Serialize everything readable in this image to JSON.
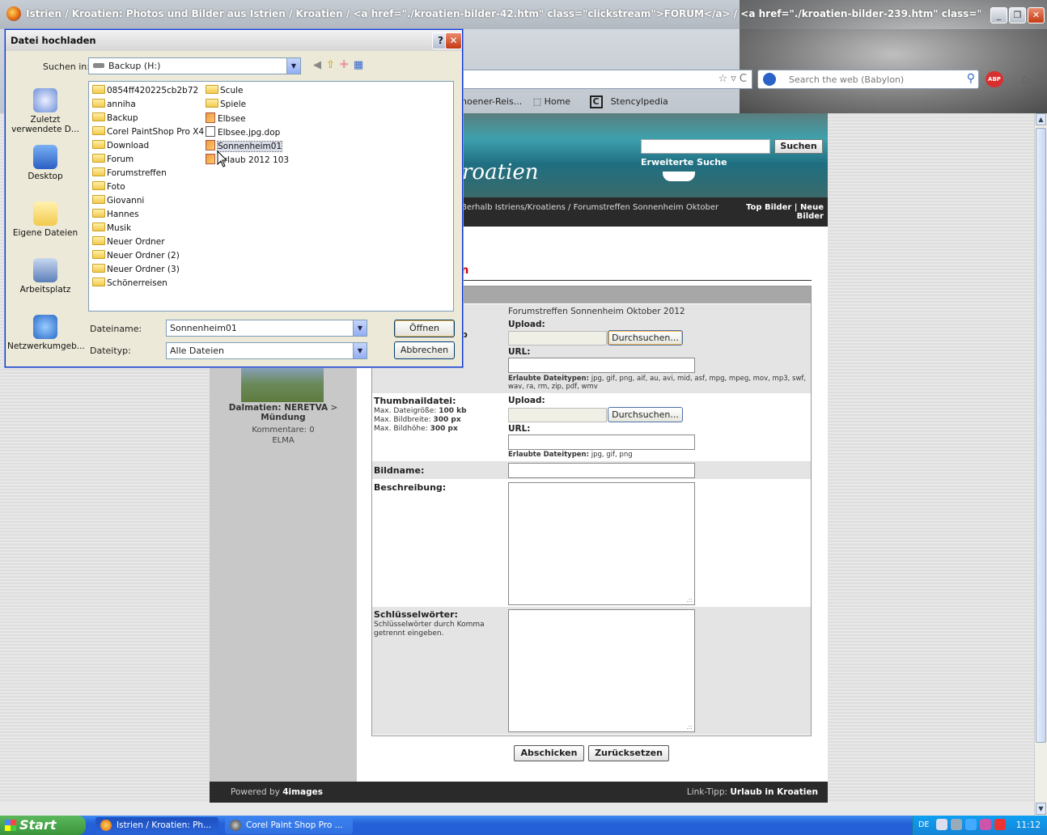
{
  "browser": {
    "window_title": "Istrien / Kroatien: Photos und Bilder aus Istrien / Kroatien / <a href=\"./kroatien-bilder-42.htm\" class=\"clickstream\">FORUM</a> / <a href=\"./kroatien-bilder-239.htm\" class=\"clickstream\"...",
    "search_placeholder": "Search the web (Babylon)",
    "bookmarks": [
      "hoener-Reis...",
      "Home",
      "Stencylpedia"
    ],
    "bookmark_c_icon": "C",
    "abp_label": "ABP"
  },
  "site": {
    "logo": "roatien",
    "search_button": "Suchen",
    "advanced_search": "Erweiterte Suche",
    "breadcrumb": "Berhalb Istriens/Kroatiens / Forumstreffen Sonnenheim Oktober",
    "top_bilder": "Top Bilder",
    "sep": "|",
    "neue_bilder": "Neue Bilder",
    "heading_fragment": "n",
    "thumb": {
      "title": "Dalmatien: NERETVA",
      "arrow": ">",
      "subtitle": "Mündung",
      "comments": "Kommentare: 0",
      "user": "ELMA"
    },
    "form": {
      "category_value": "Forumstreffen Sonnenheim Oktober 2012",
      "partial_label": "b",
      "upload_label": "Upload:",
      "browse_button": "Durchsuchen...",
      "url_label": "URL:",
      "allowed_label": "Erlaubte Dateitypen:",
      "allowed_main": "jpg, gif, png, aif, au, avi, mid, asf, mpg, mpeg, mov, mp3, swf, wav, ra, rm, zip, pdf, wmv",
      "thumb_label": "Thumbnaildatei:",
      "thumb_size_lbl": "Max. Dateigröße:",
      "thumb_size": "100 kb",
      "thumb_w_lbl": "Max. Bildbreite:",
      "thumb_w": "300 px",
      "thumb_h_lbl": "Max. Bildhöhe:",
      "thumb_h": "300 px",
      "allowed_thumb": "jpg, gif, png",
      "name_label": "Bildname:",
      "desc_label": "Beschreibung:",
      "keywords_label": "Schlüsselwörter:",
      "keywords_hint": "Schlüsselwörter durch Komma getrennt eingeben.",
      "submit": "Abschicken",
      "reset": "Zurücksetzen"
    },
    "footer_left": "Powered by",
    "footer_brand": "4images",
    "footer_right": "Link-Tipp:",
    "footer_link": "Urlaub in Kroatien"
  },
  "dialog": {
    "title": "Datei hochladen",
    "lookin_label": "Suchen in:",
    "lookin_value": "Backup (H:)",
    "places": [
      "Zuletzt verwendete D...",
      "Desktop",
      "Eigene Dateien",
      "Arbeitsplatz",
      "Netzwerkumgeb..."
    ],
    "files_col1": [
      "0854ff420225cb2b72",
      "anniha",
      "Backup",
      "Corel PaintShop Pro X4",
      "Download",
      "Forum",
      "Forumstreffen",
      "Foto",
      "Giovanni",
      "Hannes",
      "Musik",
      "Neuer Ordner",
      "Neuer Ordner (2)",
      "Neuer Ordner (3)",
      "Schönerreisen"
    ],
    "files_col2": [
      "Scule",
      "Spiele",
      "Elbsee",
      "Elbsee.jpg.dop",
      "Sonnenheim01",
      "Urlaub 2012 103"
    ],
    "filename_label": "Dateiname:",
    "filename_value": "Sonnenheim01",
    "filetype_label": "Dateityp:",
    "filetype_value": "Alle Dateien",
    "open_button": "Öffnen",
    "cancel_button": "Abbrechen",
    "help_glyph": "?",
    "close_glyph": "✕"
  },
  "taskbar": {
    "start": "Start",
    "tasks": [
      "Istrien / Kroatien: Ph...",
      "Corel Paint Shop Pro ..."
    ],
    "lang": "DE",
    "clock": "11:12"
  }
}
